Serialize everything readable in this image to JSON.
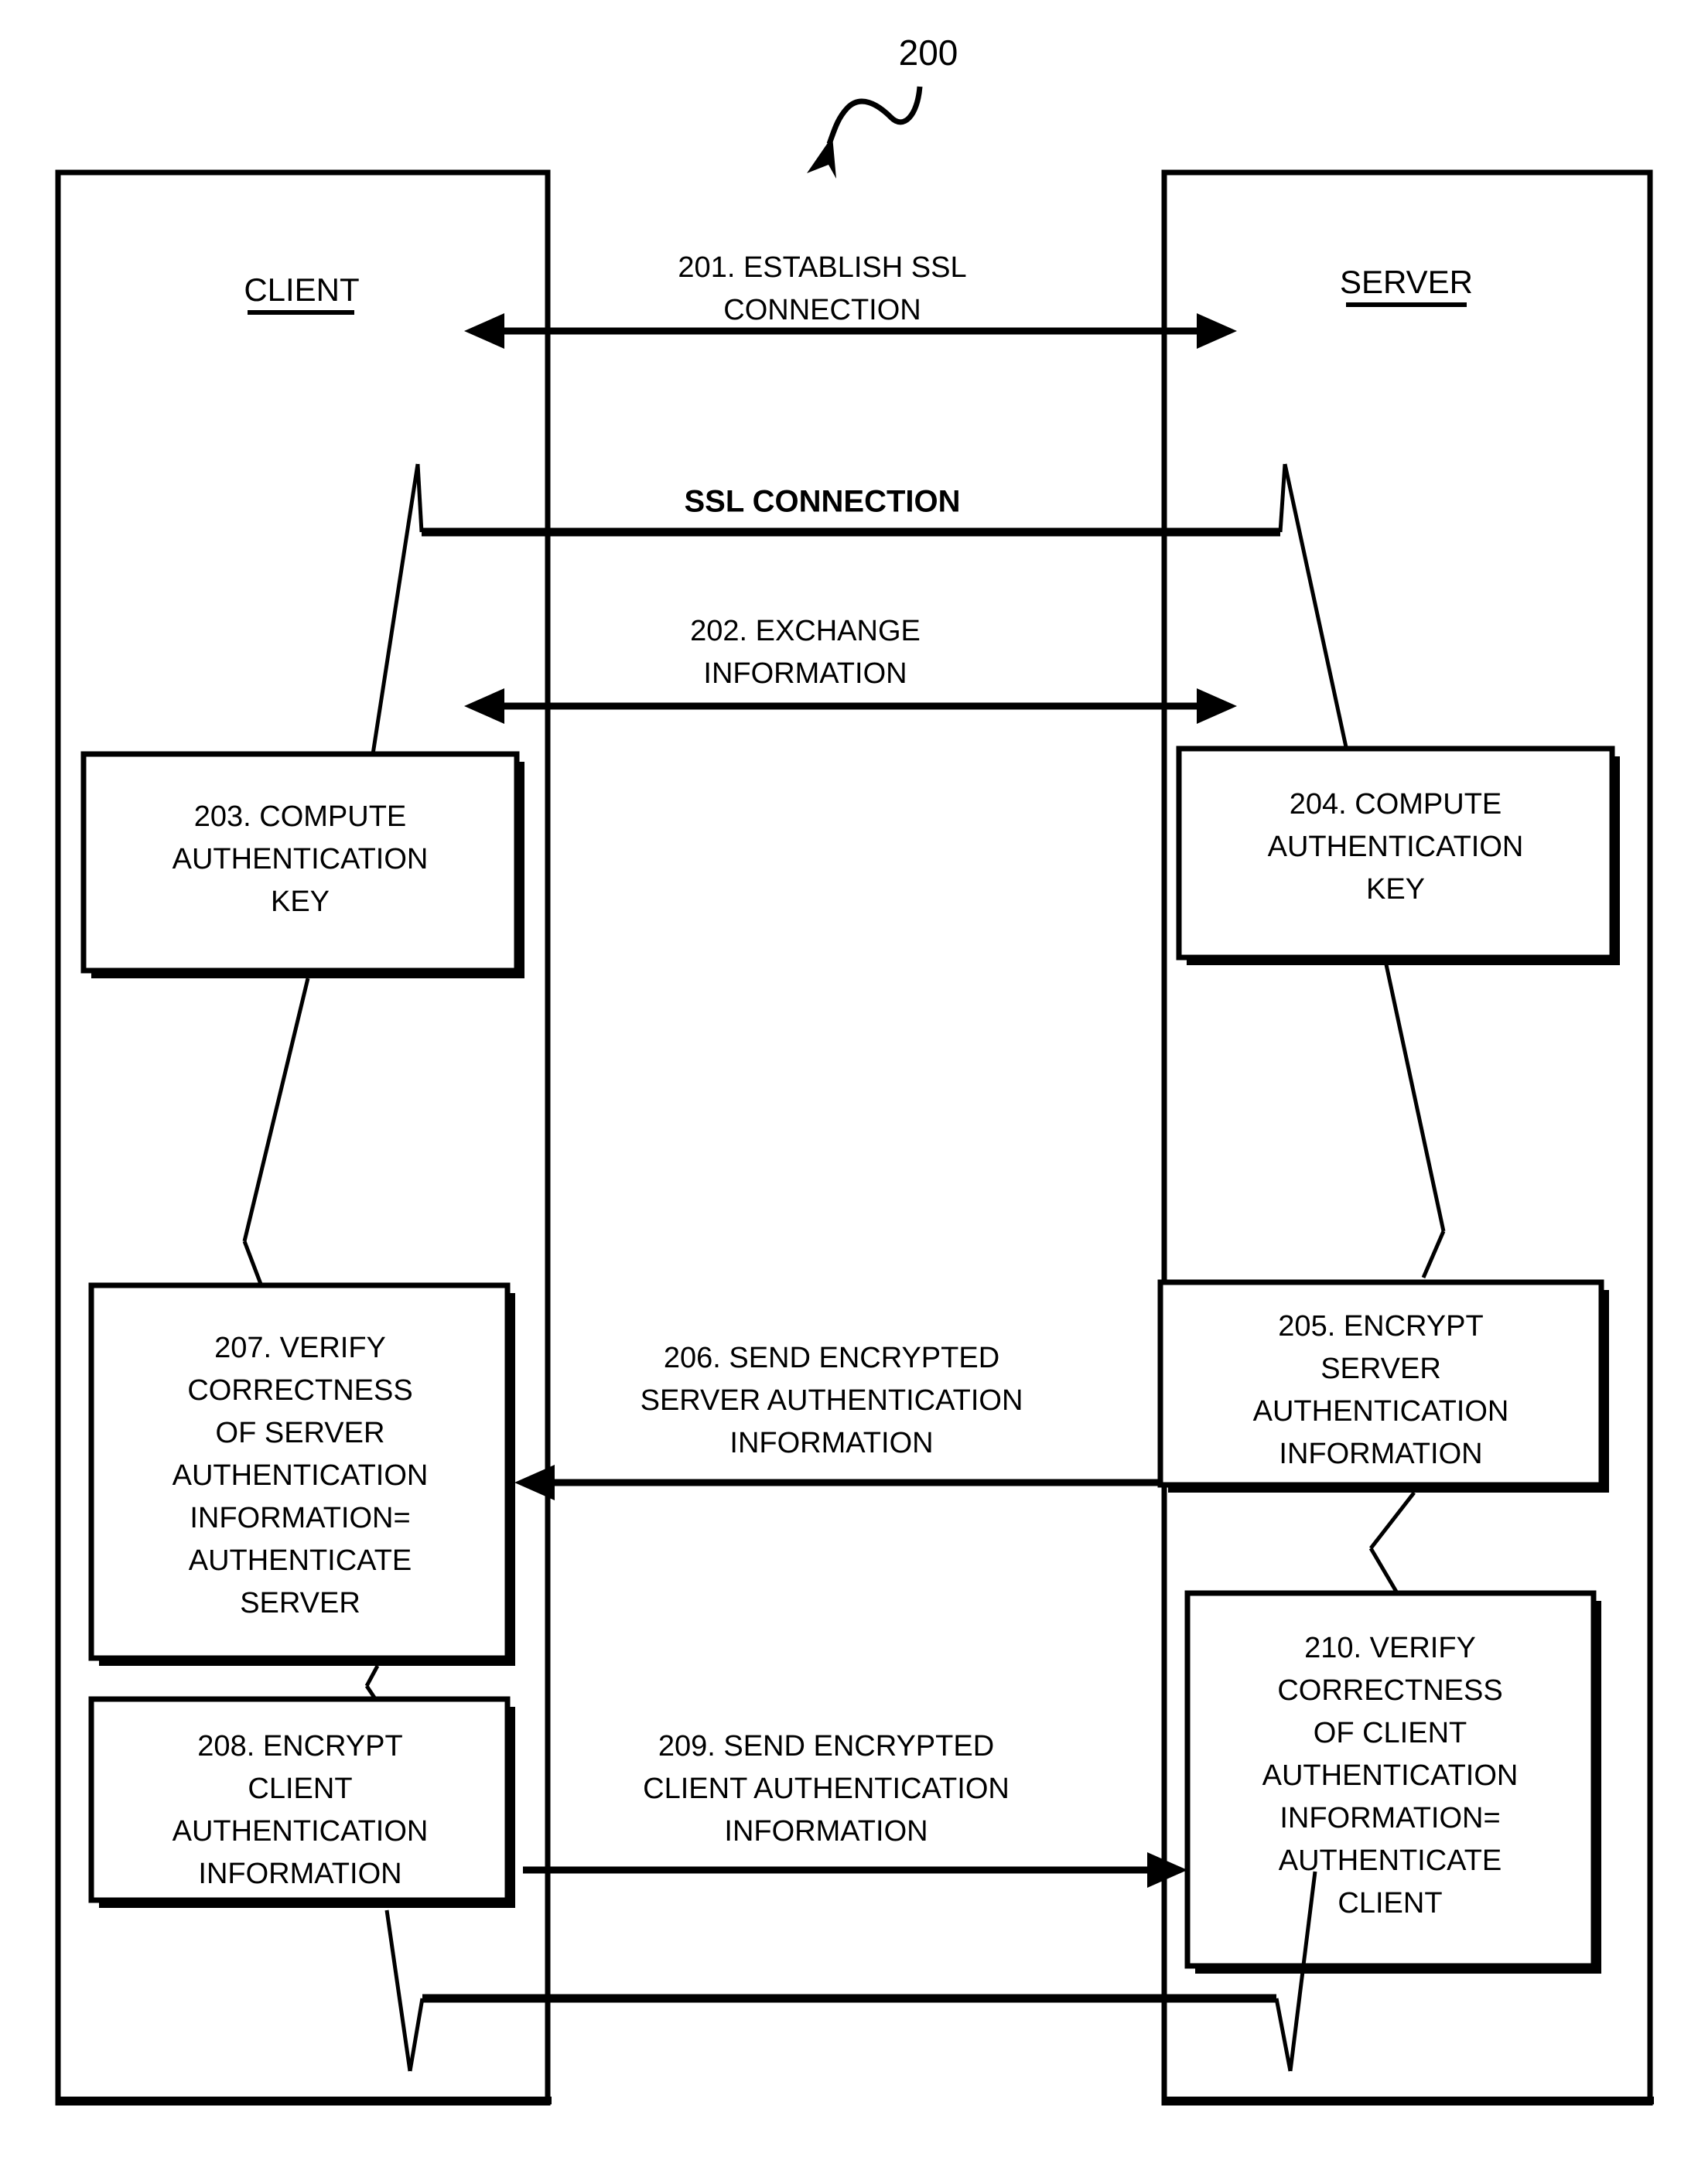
{
  "figure": {
    "reference_numeral": "200",
    "title_client": "CLIENT",
    "title_server": "SERVER",
    "ssl_band_label": "SSL CONNECTION"
  },
  "messages": [
    {
      "id": "201",
      "lines": [
        "201. ESTABLISH SSL",
        "CONNECTION"
      ],
      "direction": "bidirectional"
    },
    {
      "id": "202",
      "lines": [
        "202. EXCHANGE",
        "INFORMATION"
      ],
      "direction": "bidirectional"
    },
    {
      "id": "206",
      "lines": [
        "206. SEND ENCRYPTED",
        "SERVER AUTHENTICATION",
        "INFORMATION"
      ],
      "direction": "server-to-client"
    },
    {
      "id": "209",
      "lines": [
        "209. SEND ENCRYPTED",
        "CLIENT AUTHENTICATION",
        "INFORMATION"
      ],
      "direction": "client-to-server"
    }
  ],
  "steps": [
    {
      "id": "203",
      "side": "client",
      "lines": [
        "203. COMPUTE",
        "AUTHENTICATION",
        "KEY"
      ]
    },
    {
      "id": "204",
      "side": "server",
      "lines": [
        "204. COMPUTE",
        "AUTHENTICATION",
        "KEY"
      ]
    },
    {
      "id": "205",
      "side": "server",
      "lines": [
        "205. ENCRYPT",
        "SERVER",
        "AUTHENTICATION",
        "INFORMATION"
      ]
    },
    {
      "id": "207",
      "side": "client",
      "lines": [
        "207. VERIFY",
        "CORRECTNESS",
        "OF SERVER",
        "AUTHENTICATION",
        "INFORMATION=",
        "AUTHENTICATE",
        "SERVER"
      ]
    },
    {
      "id": "208",
      "side": "client",
      "lines": [
        "208. ENCRYPT",
        "CLIENT",
        "AUTHENTICATION",
        "INFORMATION"
      ]
    },
    {
      "id": "210",
      "side": "server",
      "lines": [
        "210. VERIFY",
        "CORRECTNESS",
        "OF CLIENT",
        "AUTHENTICATION",
        "INFORMATION=",
        "AUTHENTICATE",
        "CLIENT"
      ]
    }
  ],
  "colors": {
    "ink": "#000000",
    "paper": "#ffffff"
  }
}
